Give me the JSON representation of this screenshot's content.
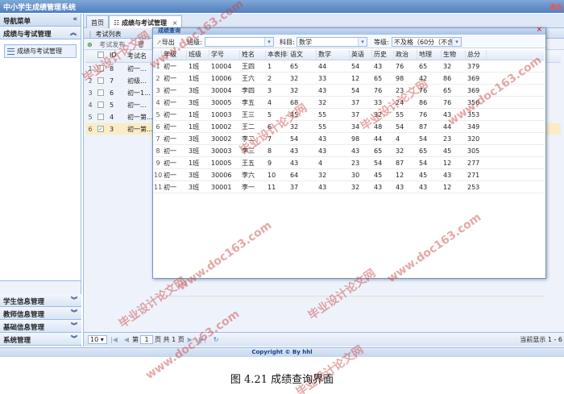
{
  "app": {
    "title": "中小学生成绩管理系统",
    "logout": "退出"
  },
  "sidebar": {
    "header": "导航菜单",
    "collapse_icon": "«",
    "active_section": "成绩与考试管理",
    "active_item": "成绩与考试管理",
    "sections": [
      "学生信息管理",
      "教师信息管理",
      "基础信息管理",
      "系统管理"
    ]
  },
  "tabs": [
    {
      "label": "首页"
    },
    {
      "label": "成绩与考试管理",
      "close": "×"
    }
  ],
  "exam_panel": {
    "title": "考试列表",
    "toolbar": {
      "publish": "考试发布",
      "delete": "删除"
    },
    "columns": [
      "ID",
      "考试名"
    ],
    "rows": [
      {
        "rn": "1",
        "id": "8",
        "name": "初一...",
        "checked": false,
        "selected": false
      },
      {
        "rn": "2",
        "id": "7",
        "name": "初级...",
        "checked": false,
        "selected": false
      },
      {
        "rn": "3",
        "id": "6",
        "name": "初一1...",
        "checked": false,
        "selected": false
      },
      {
        "rn": "4",
        "id": "5",
        "name": "初一...",
        "checked": false,
        "selected": false
      },
      {
        "rn": "5",
        "id": "4",
        "name": "初一第...",
        "checked": false,
        "selected": false
      },
      {
        "rn": "6",
        "id": "3",
        "name": "初一第...",
        "checked": true,
        "selected": true
      }
    ]
  },
  "pager": {
    "page_size": "10",
    "page_label_pre": "第",
    "page_value": "1",
    "page_label_post": "页 共 1 页",
    "info": "当前显示 1 - 6"
  },
  "dialog": {
    "title": "成绩查询",
    "export_label": "导出",
    "grade_label": "班级:",
    "grade_value": "",
    "subject_label": "科目:",
    "subject_value": "数学",
    "level_label": "等级:",
    "level_value": "不及格（60分（不含）",
    "columns": [
      "年级",
      "班级",
      "学号",
      "姓名",
      "本表排名",
      "语文",
      "数学",
      "英语",
      "历史",
      "政治",
      "地理",
      "生物",
      "总分"
    ],
    "rows": [
      [
        "初一",
        "1班",
        "10004",
        "王四",
        "1",
        "65",
        "44",
        "54",
        "43",
        "76",
        "65",
        "32",
        "379"
      ],
      [
        "初一",
        "1班",
        "10006",
        "王六",
        "2",
        "32",
        "33",
        "12",
        "65",
        "98",
        "42",
        "86",
        "369"
      ],
      [
        "初一",
        "3班",
        "30004",
        "李四",
        "3",
        "32",
        "43",
        "54",
        "76",
        "23",
        "76",
        "65",
        "369"
      ],
      [
        "初一",
        "3班",
        "30005",
        "李五",
        "4",
        "68",
        "32",
        "37",
        "33",
        "24",
        "86",
        "76",
        "356"
      ],
      [
        "初一",
        "1班",
        "10003",
        "王三",
        "5",
        "45",
        "55",
        "37",
        "32",
        "55",
        "76",
        "43",
        "353"
      ],
      [
        "初一",
        "1班",
        "10002",
        "王二",
        "6",
        "32",
        "55",
        "34",
        "48",
        "54",
        "87",
        "44",
        "349"
      ],
      [
        "初一",
        "3班",
        "30002",
        "李二",
        "7",
        "54",
        "43",
        "98",
        "44",
        "4",
        "54",
        "23",
        "320"
      ],
      [
        "初一",
        "3班",
        "30003",
        "李三",
        "8",
        "43",
        "43",
        "43",
        "65",
        "32",
        "65",
        "45",
        "305"
      ],
      [
        "初一",
        "1班",
        "10005",
        "王五",
        "9",
        "43",
        "4",
        "23",
        "54",
        "87",
        "54",
        "12",
        "277"
      ],
      [
        "初一",
        "3班",
        "30006",
        "李六",
        "10",
        "64",
        "32",
        "30",
        "45",
        "12",
        "45",
        "43",
        "271"
      ],
      [
        "初一",
        "3班",
        "30001",
        "李一",
        "11",
        "37",
        "43",
        "32",
        "43",
        "43",
        "43",
        "12",
        "253"
      ]
    ]
  },
  "footer": "Copyright © By hhl",
  "caption": "图 4.21  成绩查询界面",
  "watermark": {
    "a": "毕业设计论文网",
    "b": "www.doc163.com"
  }
}
